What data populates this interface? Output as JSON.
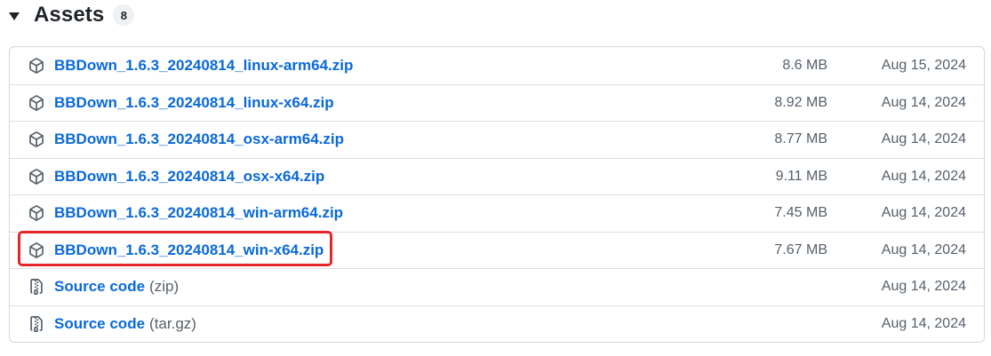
{
  "assets": {
    "title": "Assets",
    "count": "8",
    "caret_icon": "triangle-down-icon",
    "items": [
      {
        "name": "BBDown_1.6.3_20240814_linux-arm64.zip",
        "suffix": "",
        "size": "8.6 MB",
        "date": "Aug 15, 2024",
        "icon": "package-icon"
      },
      {
        "name": "BBDown_1.6.3_20240814_linux-x64.zip",
        "suffix": "",
        "size": "8.92 MB",
        "date": "Aug 14, 2024",
        "icon": "package-icon"
      },
      {
        "name": "BBDown_1.6.3_20240814_osx-arm64.zip",
        "suffix": "",
        "size": "8.77 MB",
        "date": "Aug 14, 2024",
        "icon": "package-icon"
      },
      {
        "name": "BBDown_1.6.3_20240814_osx-x64.zip",
        "suffix": "",
        "size": "9.11 MB",
        "date": "Aug 14, 2024",
        "icon": "package-icon"
      },
      {
        "name": "BBDown_1.6.3_20240814_win-arm64.zip",
        "suffix": "",
        "size": "7.45 MB",
        "date": "Aug 14, 2024",
        "icon": "package-icon"
      },
      {
        "name": "BBDown_1.6.3_20240814_win-x64.zip",
        "suffix": "",
        "size": "7.67 MB",
        "date": "Aug 14, 2024",
        "icon": "package-icon",
        "highlighted": true
      },
      {
        "name": "Source code",
        "suffix": "(zip)",
        "size": "",
        "date": "Aug 14, 2024",
        "icon": "file-zip-icon"
      },
      {
        "name": "Source code",
        "suffix": "(tar.gz)",
        "size": "",
        "date": "Aug 14, 2024",
        "icon": "file-zip-icon"
      }
    ]
  },
  "colors": {
    "link": "#0969da",
    "muted": "#57606a",
    "border": "#d0d7de",
    "highlight": "#e5252a"
  }
}
